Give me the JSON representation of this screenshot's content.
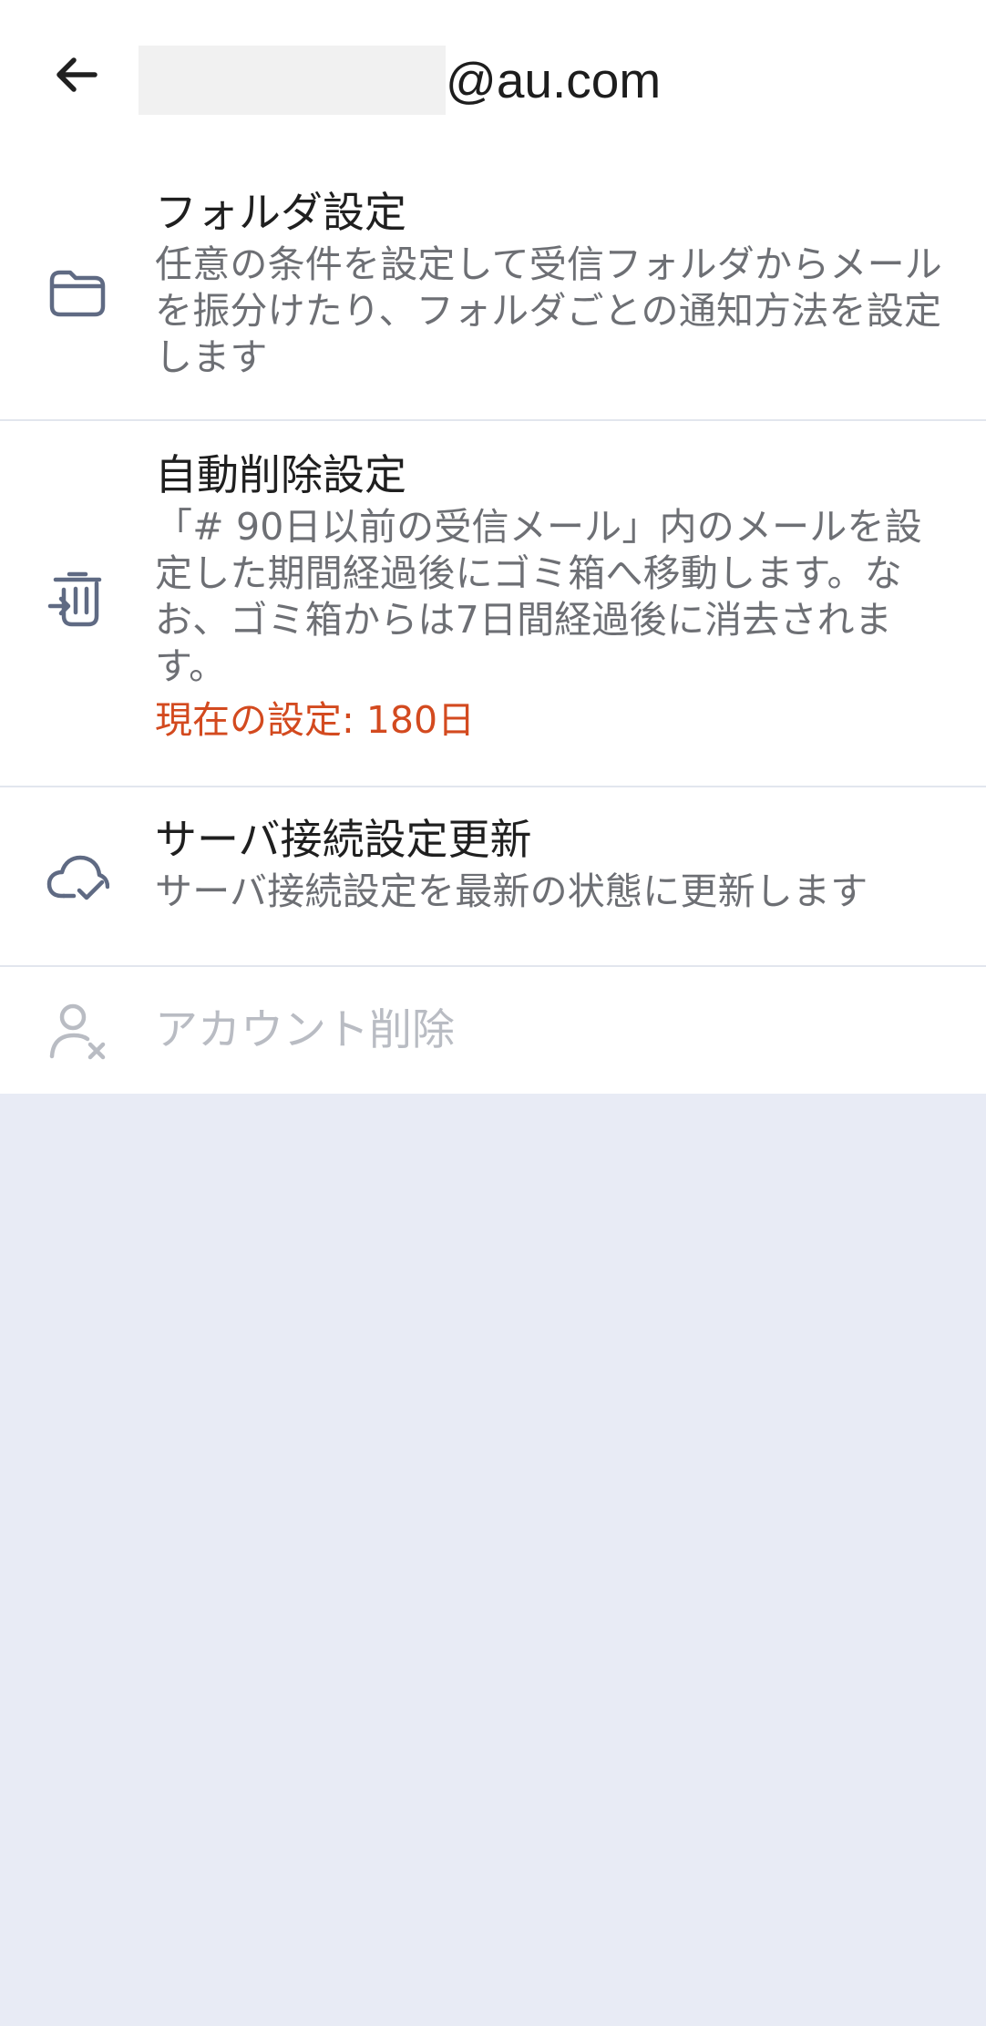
{
  "header": {
    "back_icon": "arrow-left-icon",
    "account_suffix": "@au.com"
  },
  "items": [
    {
      "icon": "folder-icon",
      "title": "フォルダ設定",
      "description": "任意の条件を設定して受信フォルダからメールを振分けたり、フォルダごとの通知方法を設定します"
    },
    {
      "icon": "trash-move-icon",
      "title": "自動削除設定",
      "description": "「# 90日以前の受信メール」内のメールを設定した期間経過後にゴミ箱へ移動します。なお、ゴミ箱からは7日間経過後に消去されます。",
      "current_setting": "現在の設定: 180日"
    },
    {
      "icon": "cloud-check-icon",
      "title": "サーバ接続設定更新",
      "description": "サーバ接続設定を最新の状態に更新します"
    },
    {
      "icon": "user-remove-icon",
      "title": "アカウント削除"
    }
  ],
  "colors": {
    "background": "#e8ebf5",
    "surface": "#ffffff",
    "accent_warning": "#d34a1f",
    "disabled_text": "#b9bcc3",
    "secondary_text": "#6d6f74",
    "icon": "#5f6a83"
  }
}
